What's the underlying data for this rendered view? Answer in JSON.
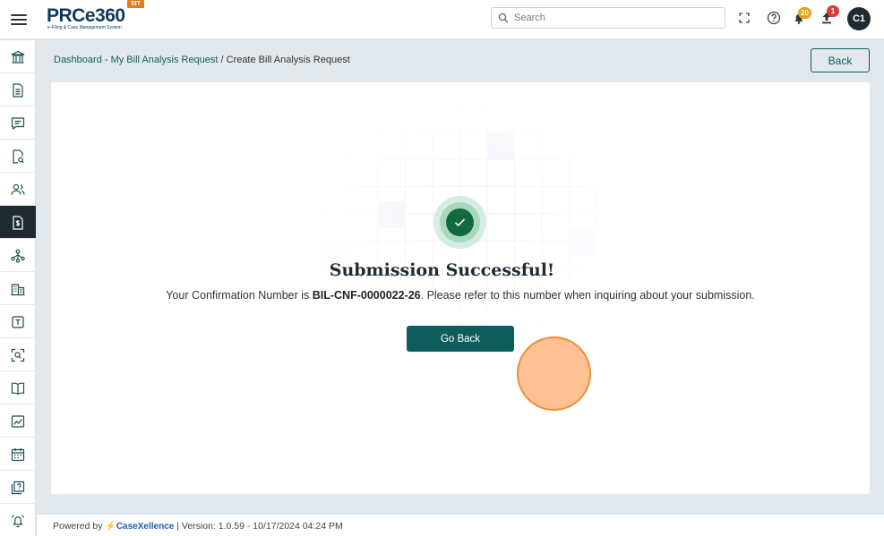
{
  "header": {
    "logo_text": "PRCe360",
    "logo_subtitle": "e-Filing & Case Management System",
    "env_badge": "SIT",
    "search_placeholder": "Search",
    "notification_count": "20",
    "upload_count": "1",
    "avatar_initials": "C1",
    "colors": {
      "notif_badge": "#e3a21a",
      "upload_badge": "#e03b3b"
    }
  },
  "sidebar": {
    "items": [
      {
        "icon": "bank-icon"
      },
      {
        "icon": "document-icon"
      },
      {
        "icon": "chat-icon"
      },
      {
        "icon": "document-search-icon"
      },
      {
        "icon": "users-icon"
      },
      {
        "icon": "bill-dollar-icon",
        "active": true
      },
      {
        "icon": "hierarchy-icon"
      },
      {
        "icon": "building-icon"
      },
      {
        "icon": "text-template-icon"
      },
      {
        "icon": "scan-search-icon"
      },
      {
        "icon": "book-open-icon"
      },
      {
        "icon": "chart-image-icon"
      },
      {
        "icon": "calendar-icon"
      },
      {
        "icon": "help-document-icon"
      },
      {
        "icon": "alarm-bell-icon"
      }
    ]
  },
  "breadcrumb": {
    "link": "Dashboard - My Bill Analysis Request",
    "separator": " / ",
    "current": "Create Bill Analysis Request"
  },
  "back_button": "Back",
  "success": {
    "title": "Submission Successful!",
    "message_prefix": "Your Confirmation Number is ",
    "confirmation_number": "BIL-CNF-0000022-26",
    "message_suffix": ". Please refer to this number when inquiring about your submission.",
    "button_label": "Go Back",
    "accent_color": "#116b3e"
  },
  "footer": {
    "powered_by": "Powered by",
    "brand": "CaseXellence",
    "divider": "|",
    "version": "Version: 1.0.59 - 10/17/2024 04:24 PM"
  }
}
